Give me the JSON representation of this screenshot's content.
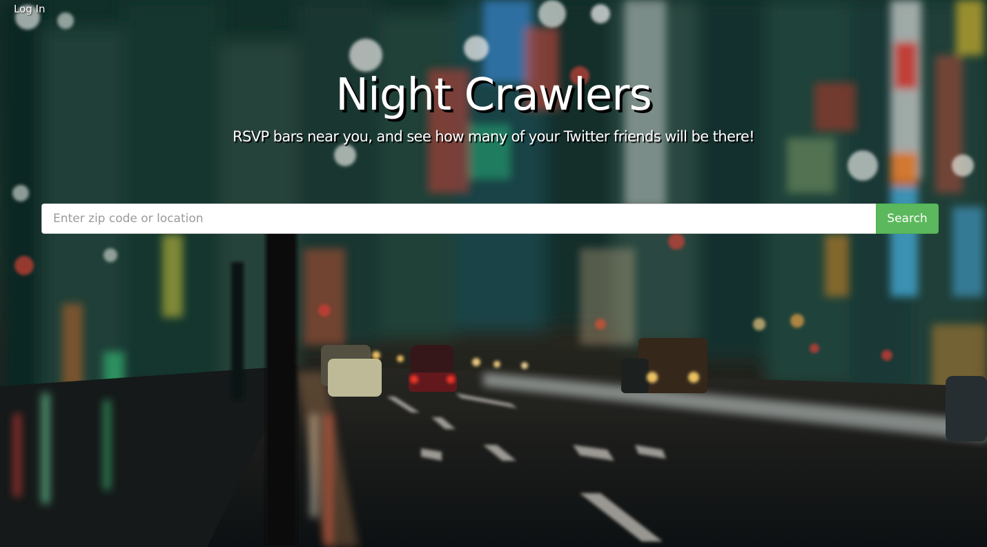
{
  "nav": {
    "login_label": "Log In"
  },
  "hero": {
    "title": "Night Crawlers",
    "subtitle": "RSVP bars near you, and see how many of your Twitter friends will be there!"
  },
  "search": {
    "placeholder": "Enter zip code or location",
    "value": "",
    "button_label": "Search"
  },
  "colors": {
    "search_button": "#5cb85c",
    "search_button_border": "#4cae4c",
    "text": "#ffffff",
    "text_shadow": "#000000"
  }
}
